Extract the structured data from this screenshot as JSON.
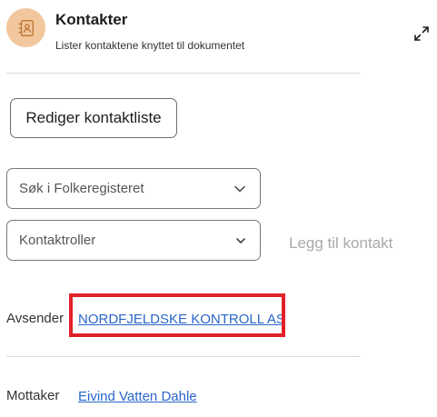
{
  "header": {
    "icon": "address-book-icon",
    "title": "Kontakter",
    "subtitle": "Lister kontaktene knyttet til dokumentet",
    "expand_icon": "expand-arrows-icon"
  },
  "actions": {
    "edit_contact_list": "Rediger kontaktliste",
    "search_registry": "Søk i Folkeregisteret",
    "contact_roles": "Kontaktroller",
    "add_contact": "Legg til kontakt"
  },
  "contacts": {
    "sender": {
      "label": "Avsender",
      "name": "NORDFJELDSKE KONTROLL AS"
    },
    "recipient": {
      "label": "Mottaker",
      "name": "Eivind Vatten Dahle"
    }
  },
  "colors": {
    "icon_background": "#f2c79d",
    "link": "#2a66c9",
    "highlight": "#e0202a",
    "disabled_text": "#a9a9a9"
  }
}
